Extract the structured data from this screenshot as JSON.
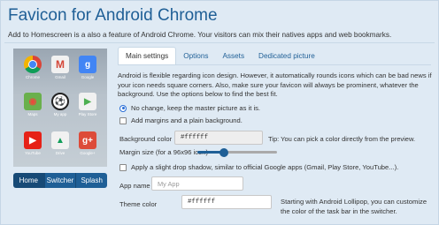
{
  "header": {
    "title": "Favicon for Android Chrome",
    "subtitle": "Add to Homescreen is a also a feature of Android Chrome. Your visitors can mix their natives apps and web bookmarks."
  },
  "preview": {
    "apps": [
      {
        "label": "Chrome",
        "icon": "chrome-icon"
      },
      {
        "label": "Gmail",
        "icon": "gmail-icon"
      },
      {
        "label": "Google",
        "icon": "google-icon"
      },
      {
        "label": "Maps",
        "icon": "maps-icon"
      },
      {
        "label": "My app",
        "icon": "my-app-icon"
      },
      {
        "label": "Play Store",
        "icon": "play-store-icon"
      },
      {
        "label": "YouTube",
        "icon": "youtube-icon"
      },
      {
        "label": "Drive",
        "icon": "drive-icon"
      },
      {
        "label": "Google+",
        "icon": "google-plus-icon"
      }
    ],
    "segments": [
      "Home",
      "Switcher",
      "Splash"
    ],
    "active_segment": "Home"
  },
  "tabs": [
    "Main settings",
    "Options",
    "Assets",
    "Dedicated picture"
  ],
  "active_tab": "Main settings",
  "settings": {
    "description": "Android is flexible regarding icon design. However, it automatically rounds icons which can be bad news if your icon needs square corners. Also, make sure your favicon will always be prominent, whatever the background. Use the options below to find the best fit.",
    "radio_no_change": "No change, keep the master picture as it is.",
    "radio_margins": "Add margins and a plain background.",
    "bg_color_label": "Background color",
    "bg_color_value": "#ffffff",
    "bg_color_tip": "Tip: You can pick a color directly from the preview.",
    "margin_label": "Margin size (for a 96x96 icon)",
    "margin_slider_fraction": 0.33,
    "shadow_label": "Apply a slight drop shadow, similar to official Google apps (Gmail, Play Store, YouTube...).",
    "app_name_label": "App name",
    "app_name_placeholder": "My App",
    "theme_color_label": "Theme color",
    "theme_color_value": "#ffffff",
    "theme_color_help": "Starting with Android Lollipop, you can customize the color of the task bar in the switcher."
  }
}
